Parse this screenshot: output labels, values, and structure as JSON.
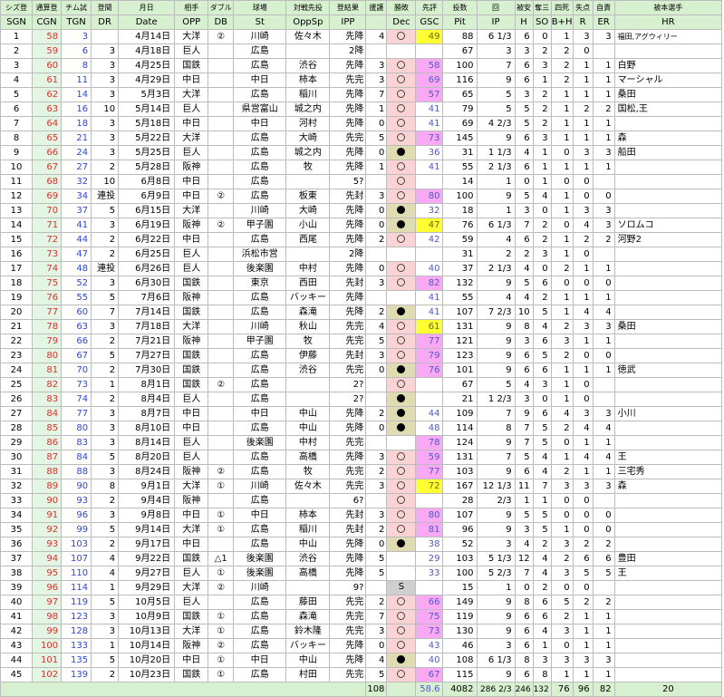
{
  "headers_jp": [
    "シズ登",
    "通算登",
    "チム試",
    "登間",
    "月日",
    "相手",
    "ダブル",
    "球場",
    "対戦先投",
    "登結果",
    "援護",
    "勝敗",
    "先評",
    "投数",
    "回",
    "被安",
    "奪三",
    "四死",
    "失点",
    "自責",
    "被本選手"
  ],
  "headers_en": [
    "SGN",
    "CGN",
    "TGN",
    "DR",
    "Date",
    "OPP",
    "DB",
    "St",
    "OppSp",
    "IPP",
    "",
    "Dec",
    "GSC",
    "Pit",
    "IP",
    "H",
    "SO",
    "B+H",
    "R",
    "ER",
    "HR"
  ],
  "rows": [
    {
      "sgn": "1",
      "cgn": "58",
      "tgn": "3",
      "dr": "",
      "date": "4月14日",
      "opp": "大洋",
      "db": "②",
      "st": "川崎",
      "oppsp": "佐々木",
      "ipp": "先降",
      "sc": "4",
      "dec": "W",
      "gsc": "49",
      "g": "y",
      "pit": "88",
      "ip": "6 1/3",
      "h": "6",
      "so": "0",
      "bh": "1",
      "r": "3",
      "er": "3",
      "hr": "福田,アグウィリー"
    },
    {
      "sgn": "2",
      "cgn": "59",
      "tgn": "6",
      "dr": "3",
      "date": "4月18日",
      "opp": "巨人",
      "db": "",
      "st": "広島",
      "oppsp": "",
      "ipp": "2降",
      "sc": "",
      "dec": "",
      "gsc": "",
      "g": "",
      "pit": "67",
      "ip": "3",
      "h": "3",
      "so": "2",
      "bh": "2",
      "r": "0",
      "er": "",
      "hr": ""
    },
    {
      "sgn": "3",
      "cgn": "60",
      "tgn": "8",
      "dr": "3",
      "date": "4月25日",
      "opp": "国鉄",
      "db": "",
      "st": "広島",
      "oppsp": "渋谷",
      "ipp": "先降",
      "sc": "3",
      "dec": "W",
      "gsc": "58",
      "g": "p",
      "pit": "100",
      "ip": "7",
      "h": "6",
      "so": "3",
      "bh": "2",
      "r": "1",
      "er": "1",
      "hr": "白野"
    },
    {
      "sgn": "4",
      "cgn": "61",
      "tgn": "11",
      "dr": "3",
      "date": "4月29日",
      "opp": "中日",
      "db": "",
      "st": "中日",
      "oppsp": "柿本",
      "ipp": "先完",
      "sc": "3",
      "dec": "W",
      "gsc": "69",
      "g": "p",
      "pit": "116",
      "ip": "9",
      "h": "6",
      "so": "1",
      "bh": "2",
      "r": "1",
      "er": "1",
      "hr": "マーシャル"
    },
    {
      "sgn": "5",
      "cgn": "62",
      "tgn": "14",
      "dr": "3",
      "date": "5月3日",
      "opp": "大洋",
      "db": "",
      "st": "広島",
      "oppsp": "稲川",
      "ipp": "先降",
      "sc": "7",
      "dec": "W",
      "gsc": "57",
      "g": "p",
      "pit": "65",
      "ip": "5",
      "h": "3",
      "so": "2",
      "bh": "1",
      "r": "1",
      "er": "1",
      "hr": "桑田"
    },
    {
      "sgn": "6",
      "cgn": "63",
      "tgn": "16",
      "dr": "10",
      "date": "5月14日",
      "opp": "巨人",
      "db": "",
      "st": "県営富山",
      "oppsp": "城之内",
      "ipp": "先降",
      "sc": "1",
      "dec": "W",
      "gsc": "41",
      "g": "",
      "pit": "79",
      "ip": "5",
      "h": "5",
      "so": "2",
      "bh": "1",
      "r": "2",
      "er": "2",
      "hr": "国松,王"
    },
    {
      "sgn": "7",
      "cgn": "64",
      "tgn": "18",
      "dr": "3",
      "date": "5月18日",
      "opp": "中日",
      "db": "",
      "st": "中日",
      "oppsp": "河村",
      "ipp": "先降",
      "sc": "0",
      "dec": "W",
      "gsc": "41",
      "g": "",
      "pit": "69",
      "ip": "4 2/3",
      "h": "5",
      "so": "2",
      "bh": "1",
      "r": "1",
      "er": "1",
      "hr": ""
    },
    {
      "sgn": "8",
      "cgn": "65",
      "tgn": "21",
      "dr": "3",
      "date": "5月22日",
      "opp": "大洋",
      "db": "",
      "st": "広島",
      "oppsp": "大崎",
      "ipp": "先完",
      "sc": "5",
      "dec": "W",
      "gsc": "73",
      "g": "p",
      "pit": "145",
      "ip": "9",
      "h": "6",
      "so": "3",
      "bh": "1",
      "r": "1",
      "er": "1",
      "hr": "森"
    },
    {
      "sgn": "9",
      "cgn": "66",
      "tgn": "24",
      "dr": "3",
      "date": "5月25日",
      "opp": "巨人",
      "db": "",
      "st": "広島",
      "oppsp": "城之内",
      "ipp": "先降",
      "sc": "0",
      "dec": "L",
      "gsc": "36",
      "g": "",
      "pit": "31",
      "ip": "1 1/3",
      "h": "4",
      "so": "1",
      "bh": "0",
      "r": "3",
      "er": "3",
      "hr": "船田"
    },
    {
      "sgn": "10",
      "cgn": "67",
      "tgn": "27",
      "dr": "2",
      "date": "5月28日",
      "opp": "阪神",
      "db": "",
      "st": "広島",
      "oppsp": "牧",
      "ipp": "先降",
      "sc": "1",
      "dec": "W",
      "gsc": "41",
      "g": "",
      "pit": "55",
      "ip": "2 1/3",
      "h": "6",
      "so": "1",
      "bh": "1",
      "r": "1",
      "er": "1",
      "hr": ""
    },
    {
      "sgn": "11",
      "cgn": "68",
      "tgn": "32",
      "dr": "10",
      "date": "6月8日",
      "opp": "中日",
      "db": "",
      "st": "広島",
      "oppsp": "",
      "ipp": "5?",
      "sc": "",
      "dec": "W",
      "gsc": "",
      "g": "",
      "pit": "14",
      "ip": "1",
      "h": "0",
      "so": "1",
      "bh": "0",
      "r": "0",
      "er": "",
      "hr": ""
    },
    {
      "sgn": "12",
      "cgn": "69",
      "tgn": "34",
      "dr": "連投",
      "date": "6月9日",
      "opp": "中日",
      "db": "②",
      "st": "広島",
      "oppsp": "板東",
      "ipp": "先封",
      "sc": "3",
      "dec": "W",
      "gsc": "80",
      "g": "p",
      "pit": "100",
      "ip": "9",
      "h": "5",
      "so": "4",
      "bh": "1",
      "r": "0",
      "er": "0",
      "hr": ""
    },
    {
      "sgn": "13",
      "cgn": "70",
      "tgn": "37",
      "dr": "5",
      "date": "6月15日",
      "opp": "大洋",
      "db": "",
      "st": "川崎",
      "oppsp": "大崎",
      "ipp": "先降",
      "sc": "0",
      "dec": "L",
      "gsc": "32",
      "g": "",
      "pit": "18",
      "ip": "1",
      "h": "3",
      "so": "0",
      "bh": "1",
      "r": "3",
      "er": "3",
      "hr": ""
    },
    {
      "sgn": "14",
      "cgn": "71",
      "tgn": "41",
      "dr": "3",
      "date": "6月19日",
      "opp": "阪神",
      "db": "②",
      "st": "甲子園",
      "oppsp": "小山",
      "ipp": "先降",
      "sc": "0",
      "dec": "L",
      "gsc": "47",
      "g": "y",
      "pit": "76",
      "ip": "6 1/3",
      "h": "7",
      "so": "2",
      "bh": "0",
      "r": "4",
      "er": "3",
      "hr": "ソロムコ"
    },
    {
      "sgn": "15",
      "cgn": "72",
      "tgn": "44",
      "dr": "2",
      "date": "6月22日",
      "opp": "中日",
      "db": "",
      "st": "広島",
      "oppsp": "西尾",
      "ipp": "先降",
      "sc": "2",
      "dec": "W",
      "gsc": "42",
      "g": "",
      "pit": "59",
      "ip": "4",
      "h": "6",
      "so": "2",
      "bh": "1",
      "r": "2",
      "er": "2",
      "hr": "河野2"
    },
    {
      "sgn": "16",
      "cgn": "73",
      "tgn": "47",
      "dr": "2",
      "date": "6月25日",
      "opp": "巨人",
      "db": "",
      "st": "浜松市営",
      "oppsp": "",
      "ipp": "2降",
      "sc": "",
      "dec": "",
      "gsc": "",
      "g": "",
      "pit": "31",
      "ip": "2",
      "h": "2",
      "so": "3",
      "bh": "1",
      "r": "0",
      "er": "",
      "hr": ""
    },
    {
      "sgn": "17",
      "cgn": "74",
      "tgn": "48",
      "dr": "連投",
      "date": "6月26日",
      "opp": "巨人",
      "db": "",
      "st": "後楽園",
      "oppsp": "中村",
      "ipp": "先降",
      "sc": "0",
      "dec": "W",
      "gsc": "40",
      "g": "",
      "pit": "37",
      "ip": "2 1/3",
      "h": "4",
      "so": "0",
      "bh": "2",
      "r": "1",
      "er": "1",
      "hr": ""
    },
    {
      "sgn": "18",
      "cgn": "75",
      "tgn": "52",
      "dr": "3",
      "date": "6月30日",
      "opp": "国鉄",
      "db": "",
      "st": "東京",
      "oppsp": "西田",
      "ipp": "先封",
      "sc": "3",
      "dec": "W",
      "gsc": "82",
      "g": "p",
      "pit": "132",
      "ip": "9",
      "h": "5",
      "so": "6",
      "bh": "0",
      "r": "0",
      "er": "0",
      "hr": ""
    },
    {
      "sgn": "19",
      "cgn": "76",
      "tgn": "55",
      "dr": "5",
      "date": "7月6日",
      "opp": "阪神",
      "db": "",
      "st": "広島",
      "oppsp": "バッキー",
      "ipp": "先降",
      "sc": "",
      "dec": "",
      "gsc": "41",
      "g": "",
      "pit": "55",
      "ip": "4",
      "h": "4",
      "so": "2",
      "bh": "1",
      "r": "1",
      "er": "1",
      "hr": ""
    },
    {
      "sgn": "20",
      "cgn": "77",
      "tgn": "60",
      "dr": "7",
      "date": "7月14日",
      "opp": "国鉄",
      "db": "",
      "st": "広島",
      "oppsp": "森滝",
      "ipp": "先降",
      "sc": "2",
      "dec": "L",
      "gsc": "41",
      "g": "",
      "pit": "107",
      "ip": "7 2/3",
      "h": "10",
      "so": "5",
      "bh": "1",
      "r": "4",
      "er": "4",
      "hr": ""
    },
    {
      "sgn": "21",
      "cgn": "78",
      "tgn": "63",
      "dr": "3",
      "date": "7月18日",
      "opp": "大洋",
      "db": "",
      "st": "川崎",
      "oppsp": "秋山",
      "ipp": "先完",
      "sc": "4",
      "dec": "W",
      "gsc": "61",
      "g": "y",
      "pit": "131",
      "ip": "9",
      "h": "8",
      "so": "4",
      "bh": "2",
      "r": "3",
      "er": "3",
      "hr": "桑田"
    },
    {
      "sgn": "22",
      "cgn": "79",
      "tgn": "66",
      "dr": "2",
      "date": "7月21日",
      "opp": "阪神",
      "db": "",
      "st": "甲子園",
      "oppsp": "牧",
      "ipp": "先完",
      "sc": "5",
      "dec": "W",
      "gsc": "77",
      "g": "p",
      "pit": "121",
      "ip": "9",
      "h": "3",
      "so": "6",
      "bh": "3",
      "r": "1",
      "er": "1",
      "hr": ""
    },
    {
      "sgn": "23",
      "cgn": "80",
      "tgn": "67",
      "dr": "5",
      "date": "7月27日",
      "opp": "国鉄",
      "db": "",
      "st": "広島",
      "oppsp": "伊藤",
      "ipp": "先封",
      "sc": "3",
      "dec": "W",
      "gsc": "79",
      "g": "p",
      "pit": "123",
      "ip": "9",
      "h": "6",
      "so": "5",
      "bh": "2",
      "r": "0",
      "er": "0",
      "hr": ""
    },
    {
      "sgn": "24",
      "cgn": "81",
      "tgn": "70",
      "dr": "2",
      "date": "7月30日",
      "opp": "国鉄",
      "db": "",
      "st": "広島",
      "oppsp": "渋谷",
      "ipp": "先完",
      "sc": "0",
      "dec": "L",
      "gsc": "76",
      "g": "p",
      "pit": "101",
      "ip": "9",
      "h": "6",
      "so": "6",
      "bh": "1",
      "r": "1",
      "er": "1",
      "hr": "徳武"
    },
    {
      "sgn": "25",
      "cgn": "82",
      "tgn": "73",
      "dr": "1",
      "date": "8月1日",
      "opp": "国鉄",
      "db": "②",
      "st": "広島",
      "oppsp": "",
      "ipp": "2?",
      "sc": "",
      "dec": "W",
      "gsc": "",
      "g": "",
      "pit": "67",
      "ip": "5",
      "h": "4",
      "so": "3",
      "bh": "1",
      "r": "0",
      "er": "",
      "hr": ""
    },
    {
      "sgn": "26",
      "cgn": "83",
      "tgn": "74",
      "dr": "2",
      "date": "8月4日",
      "opp": "巨人",
      "db": "",
      "st": "広島",
      "oppsp": "",
      "ipp": "2?",
      "sc": "",
      "dec": "L",
      "gsc": "",
      "g": "",
      "pit": "21",
      "ip": "1 2/3",
      "h": "3",
      "so": "0",
      "bh": "1",
      "r": "0",
      "er": "",
      "hr": ""
    },
    {
      "sgn": "27",
      "cgn": "84",
      "tgn": "77",
      "dr": "3",
      "date": "8月7日",
      "opp": "中日",
      "db": "",
      "st": "中日",
      "oppsp": "中山",
      "ipp": "先降",
      "sc": "2",
      "dec": "L",
      "gsc": "44",
      "g": "",
      "pit": "109",
      "ip": "7",
      "h": "9",
      "so": "6",
      "bh": "4",
      "r": "3",
      "er": "3",
      "hr": "小川"
    },
    {
      "sgn": "28",
      "cgn": "85",
      "tgn": "80",
      "dr": "3",
      "date": "8月10日",
      "opp": "中日",
      "db": "",
      "st": "広島",
      "oppsp": "中山",
      "ipp": "先降",
      "sc": "0",
      "dec": "L",
      "gsc": "48",
      "g": "",
      "pit": "114",
      "ip": "8",
      "h": "7",
      "so": "5",
      "bh": "2",
      "r": "4",
      "er": "4",
      "hr": ""
    },
    {
      "sgn": "29",
      "cgn": "86",
      "tgn": "83",
      "dr": "3",
      "date": "8月14日",
      "opp": "巨人",
      "db": "",
      "st": "後楽園",
      "oppsp": "中村",
      "ipp": "先完",
      "sc": "",
      "dec": "",
      "gsc": "78",
      "g": "p",
      "pit": "124",
      "ip": "9",
      "h": "7",
      "so": "5",
      "bh": "0",
      "r": "1",
      "er": "1",
      "hr": ""
    },
    {
      "sgn": "30",
      "cgn": "87",
      "tgn": "84",
      "dr": "5",
      "date": "8月20日",
      "opp": "巨人",
      "db": "",
      "st": "広島",
      "oppsp": "高橋",
      "ipp": "先降",
      "sc": "3",
      "dec": "W",
      "gsc": "59",
      "g": "p",
      "pit": "131",
      "ip": "7",
      "h": "5",
      "so": "4",
      "bh": "1",
      "r": "4",
      "er": "4",
      "hr": "王"
    },
    {
      "sgn": "31",
      "cgn": "88",
      "tgn": "88",
      "dr": "3",
      "date": "8月24日",
      "opp": "阪神",
      "db": "②",
      "st": "広島",
      "oppsp": "牧",
      "ipp": "先完",
      "sc": "2",
      "dec": "W",
      "gsc": "77",
      "g": "p",
      "pit": "103",
      "ip": "9",
      "h": "6",
      "so": "4",
      "bh": "2",
      "r": "1",
      "er": "1",
      "hr": "三宅秀"
    },
    {
      "sgn": "32",
      "cgn": "89",
      "tgn": "90",
      "dr": "8",
      "date": "9月1日",
      "opp": "大洋",
      "db": "①",
      "st": "川崎",
      "oppsp": "佐々木",
      "ipp": "先完",
      "sc": "3",
      "dec": "W",
      "gsc": "72",
      "g": "y",
      "pit": "167",
      "ip": "12 1/3",
      "h": "11",
      "so": "7",
      "bh": "3",
      "r": "3",
      "er": "3",
      "hr": "森"
    },
    {
      "sgn": "33",
      "cgn": "90",
      "tgn": "93",
      "dr": "2",
      "date": "9月4日",
      "opp": "阪神",
      "db": "",
      "st": "広島",
      "oppsp": "",
      "ipp": "6?",
      "sc": "",
      "dec": "W",
      "gsc": "",
      "g": "",
      "pit": "28",
      "ip": "2/3",
      "h": "1",
      "so": "1",
      "bh": "0",
      "r": "0",
      "er": "",
      "hr": ""
    },
    {
      "sgn": "34",
      "cgn": "91",
      "tgn": "96",
      "dr": "3",
      "date": "9月8日",
      "opp": "中日",
      "db": "①",
      "st": "中日",
      "oppsp": "柿本",
      "ipp": "先封",
      "sc": "3",
      "dec": "W",
      "gsc": "80",
      "g": "p",
      "pit": "107",
      "ip": "9",
      "h": "5",
      "so": "5",
      "bh": "0",
      "r": "0",
      "er": "0",
      "hr": ""
    },
    {
      "sgn": "35",
      "cgn": "92",
      "tgn": "99",
      "dr": "5",
      "date": "9月14日",
      "opp": "大洋",
      "db": "①",
      "st": "広島",
      "oppsp": "稲川",
      "ipp": "先封",
      "sc": "2",
      "dec": "W",
      "gsc": "81",
      "g": "p",
      "pit": "96",
      "ip": "9",
      "h": "3",
      "so": "5",
      "bh": "1",
      "r": "0",
      "er": "0",
      "hr": ""
    },
    {
      "sgn": "36",
      "cgn": "93",
      "tgn": "103",
      "dr": "2",
      "date": "9月17日",
      "opp": "中日",
      "db": "",
      "st": "広島",
      "oppsp": "中山",
      "ipp": "先降",
      "sc": "0",
      "dec": "L",
      "gsc": "38",
      "g": "",
      "pit": "52",
      "ip": "3",
      "h": "4",
      "so": "2",
      "bh": "3",
      "r": "2",
      "er": "2",
      "hr": ""
    },
    {
      "sgn": "37",
      "cgn": "94",
      "tgn": "107",
      "dr": "4",
      "date": "9月22日",
      "opp": "国鉄",
      "db": "△1",
      "st": "後楽園",
      "oppsp": "渋谷",
      "ipp": "先降",
      "sc": "5",
      "dec": "",
      "gsc": "29",
      "g": "",
      "pit": "103",
      "ip": "5 1/3",
      "h": "12",
      "so": "4",
      "bh": "2",
      "r": "6",
      "er": "6",
      "hr": "豊田"
    },
    {
      "sgn": "38",
      "cgn": "95",
      "tgn": "110",
      "dr": "4",
      "date": "9月27日",
      "opp": "巨人",
      "db": "①",
      "st": "後楽園",
      "oppsp": "高橋",
      "ipp": "先降",
      "sc": "5",
      "dec": "",
      "gsc": "33",
      "g": "",
      "pit": "100",
      "ip": "5 2/3",
      "h": "7",
      "so": "4",
      "bh": "3",
      "r": "5",
      "er": "5",
      "hr": "王"
    },
    {
      "sgn": "39",
      "cgn": "96",
      "tgn": "114",
      "dr": "1",
      "date": "9月29日",
      "opp": "大洋",
      "db": "②",
      "st": "川崎",
      "oppsp": "",
      "ipp": "9?",
      "sc": "",
      "dec": "S",
      "gsc": "",
      "g": "",
      "pit": "15",
      "ip": "1",
      "h": "0",
      "so": "2",
      "bh": "0",
      "r": "0",
      "er": "",
      "hr": ""
    },
    {
      "sgn": "40",
      "cgn": "97",
      "tgn": "119",
      "dr": "5",
      "date": "10月5日",
      "opp": "巨人",
      "db": "",
      "st": "広島",
      "oppsp": "藤田",
      "ipp": "先完",
      "sc": "2",
      "dec": "W",
      "gsc": "66",
      "g": "p",
      "pit": "149",
      "ip": "9",
      "h": "8",
      "so": "6",
      "bh": "5",
      "r": "2",
      "er": "2",
      "hr": ""
    },
    {
      "sgn": "41",
      "cgn": "98",
      "tgn": "123",
      "dr": "3",
      "date": "10月9日",
      "opp": "国鉄",
      "db": "①",
      "st": "広島",
      "oppsp": "森滝",
      "ipp": "先完",
      "sc": "7",
      "dec": "W",
      "gsc": "75",
      "g": "p",
      "pit": "119",
      "ip": "9",
      "h": "6",
      "so": "6",
      "bh": "2",
      "r": "1",
      "er": "1",
      "hr": ""
    },
    {
      "sgn": "42",
      "cgn": "99",
      "tgn": "128",
      "dr": "3",
      "date": "10月13日",
      "opp": "大洋",
      "db": "①",
      "st": "広島",
      "oppsp": "鈴木隆",
      "ipp": "先完",
      "sc": "3",
      "dec": "W",
      "gsc": "73",
      "g": "p",
      "pit": "130",
      "ip": "9",
      "h": "6",
      "so": "4",
      "bh": "3",
      "r": "1",
      "er": "1",
      "hr": ""
    },
    {
      "sgn": "43",
      "cgn": "100",
      "tgn": "133",
      "dr": "1",
      "date": "10月14日",
      "opp": "阪神",
      "db": "②",
      "st": "広島",
      "oppsp": "バッキー",
      "ipp": "先降",
      "sc": "0",
      "dec": "W",
      "gsc": "43",
      "g": "",
      "pit": "46",
      "ip": "3",
      "h": "6",
      "so": "1",
      "bh": "0",
      "r": "1",
      "er": "1",
      "hr": ""
    },
    {
      "sgn": "44",
      "cgn": "101",
      "tgn": "135",
      "dr": "5",
      "date": "10月20日",
      "opp": "中日",
      "db": "①",
      "st": "中日",
      "oppsp": "中山",
      "ipp": "先降",
      "sc": "4",
      "dec": "L",
      "gsc": "40",
      "g": "",
      "pit": "108",
      "ip": "6 1/3",
      "h": "8",
      "so": "3",
      "bh": "3",
      "r": "3",
      "er": "3",
      "hr": ""
    },
    {
      "sgn": "45",
      "cgn": "102",
      "tgn": "139",
      "dr": "2",
      "date": "10月23日",
      "opp": "国鉄",
      "db": "①",
      "st": "広島",
      "oppsp": "村田",
      "ipp": "先完",
      "sc": "5",
      "dec": "W",
      "gsc": "67",
      "g": "p",
      "pit": "115",
      "ip": "9",
      "h": "6",
      "so": "8",
      "bh": "1",
      "r": "1",
      "er": "1",
      "hr": ""
    }
  ],
  "totals": {
    "sc": "108",
    "gsc": "58.6",
    "pit": "4082",
    "ip": "286 2/3",
    "h": "246",
    "so": "132",
    "bh": "76",
    "r": "96",
    "er": "82",
    "hr": "20"
  },
  "colors": {
    "header_bg": "#d7f0cf",
    "cgn": "#d83030",
    "tgn": "#2a46d6",
    "dec_win": "#fbd3d5",
    "dec_loss": "#dedcb0",
    "gsc_yellow": "#ffff33",
    "gsc_pink": "#f9a9f4"
  }
}
